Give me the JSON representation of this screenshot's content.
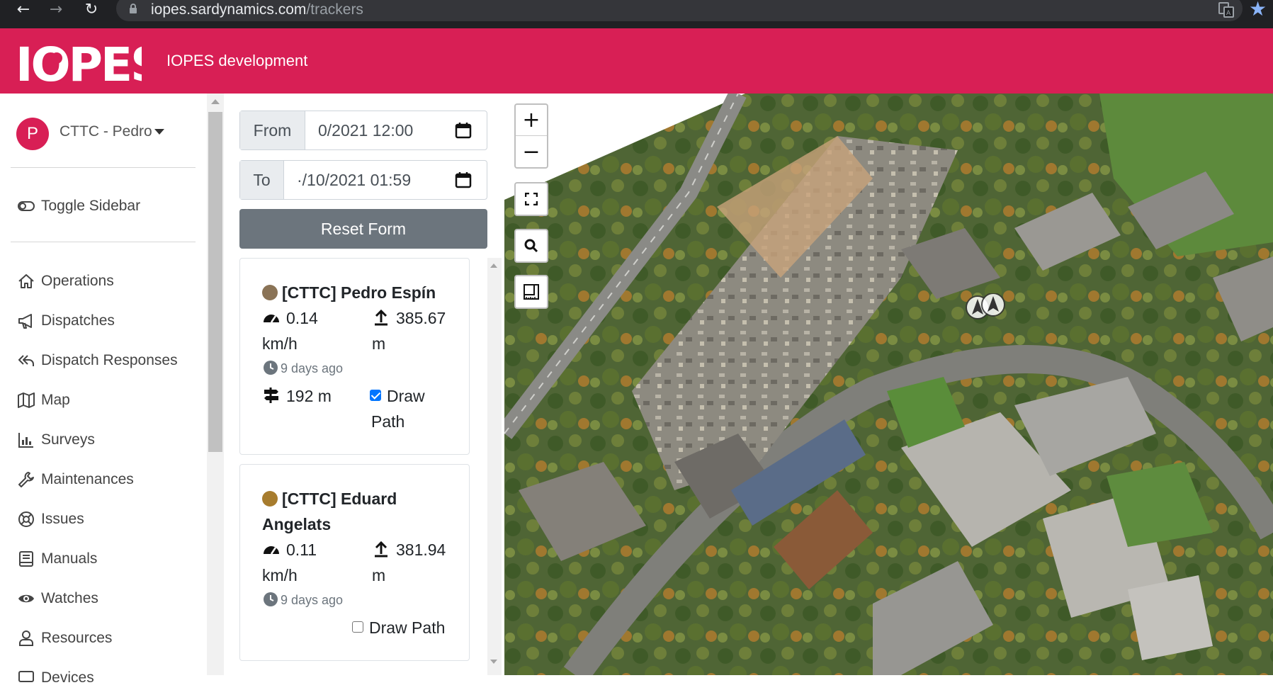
{
  "browser": {
    "url_host": "iopes.sardynamics.com",
    "url_path": "/trackers"
  },
  "header": {
    "logo_text": "IOPES",
    "app_title": "IOPES development",
    "accent_color": "#d81f55"
  },
  "sidebar": {
    "avatar_letter": "P",
    "user_name": "CTTC - Pedro",
    "toggle_label": "Toggle Sidebar",
    "items": [
      {
        "label": "Operations",
        "icon": "home-icon"
      },
      {
        "label": "Dispatches",
        "icon": "megaphone-icon"
      },
      {
        "label": "Dispatch Responses",
        "icon": "reply-all-icon"
      },
      {
        "label": "Map",
        "icon": "map-icon"
      },
      {
        "label": "Surveys",
        "icon": "bar-chart-icon"
      },
      {
        "label": "Maintenances",
        "icon": "wrench-icon"
      },
      {
        "label": "Issues",
        "icon": "life-ring-icon"
      },
      {
        "label": "Manuals",
        "icon": "book-icon"
      },
      {
        "label": "Watches",
        "icon": "eye-icon"
      },
      {
        "label": "Resources",
        "icon": "user-icon"
      },
      {
        "label": "Devices",
        "icon": "device-icon"
      }
    ]
  },
  "filters": {
    "from_label": "From",
    "from_value": "0/2021 12:00",
    "to_label": "To",
    "to_value": "·/10/2021 01:59",
    "reset_label": "Reset Form"
  },
  "trackers": [
    {
      "name": "[CTTC] Pedro Espín",
      "color": "#8a7356",
      "speed_value": "0.14",
      "speed_unit": "km/h",
      "altitude_value": "385.67",
      "altitude_unit": "m",
      "last_seen": "9 days ago",
      "distance": "192 m",
      "draw_path_label_1": "Draw",
      "draw_path_label_2": "Path",
      "draw_path_checked": true
    },
    {
      "name_line1": "[CTTC] Eduard",
      "name_line2": "Angelats",
      "color": "#a77c2e",
      "speed_value": "0.11",
      "speed_unit": "km/h",
      "altitude_value": "381.94",
      "altitude_unit": "m",
      "last_seen": "9 days ago",
      "draw_path_label": "Draw Path",
      "draw_path_checked": false
    }
  ],
  "map": {
    "zoom_in": "+",
    "zoom_out": "−"
  }
}
